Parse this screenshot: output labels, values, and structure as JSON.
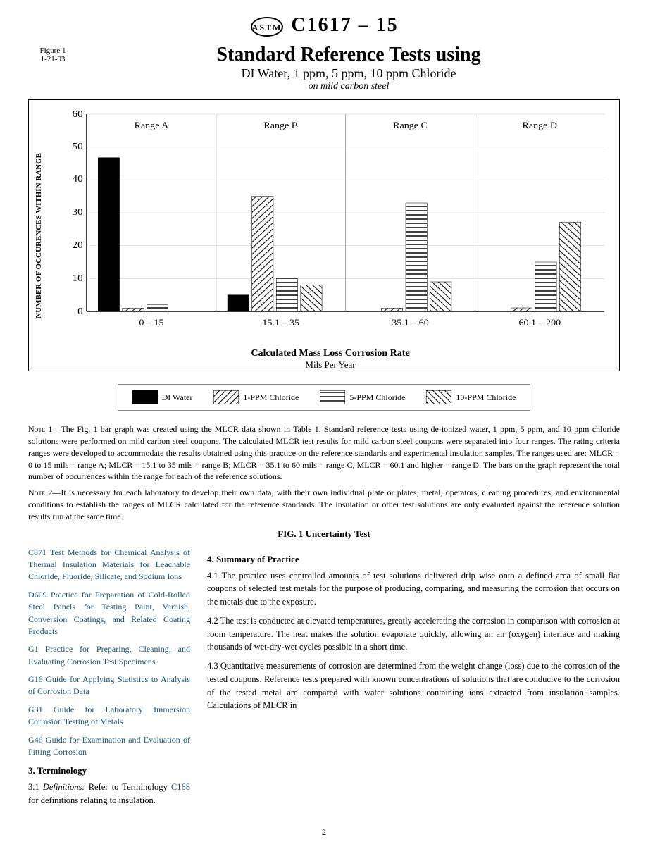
{
  "header": {
    "logo": "⚙",
    "standard": "C1617 – 15"
  },
  "figure": {
    "label": "Figure 1",
    "label2": "1-21-03",
    "title": "Standard Reference Tests using",
    "subtitle": "DI Water, 1 ppm, 5 ppm, 10 ppm Chloride",
    "sub2": "on mild carbon steel"
  },
  "chart": {
    "y_label": "NUMBER OF OCCURENCES WITHIN RANGE",
    "y_ticks": [
      "60",
      "50",
      "40",
      "30",
      "20",
      "10",
      "0"
    ],
    "ranges": [
      "Range A",
      "Range B",
      "Range C",
      "Range D"
    ],
    "x_labels": [
      "0 – 15",
      "15.1 – 35",
      "35.1 – 60",
      "60.1 – 200"
    ],
    "x_axis_label": "Calculated Mass Loss Corrosion Rate",
    "x_axis_sub": "Mils Per Year",
    "bars": {
      "rangeA": [
        47,
        1,
        2,
        0
      ],
      "rangeB": [
        5,
        35,
        10,
        8
      ],
      "rangeC": [
        0,
        1,
        33,
        9
      ],
      "rangeD": [
        0,
        0,
        15,
        27
      ]
    }
  },
  "legend": {
    "items": [
      {
        "label": "DI Water",
        "pattern": "solid"
      },
      {
        "label": "1-PPM Chloride",
        "pattern": "diagonal"
      },
      {
        "label": "5-PPM Chloride",
        "pattern": "horizontal"
      },
      {
        "label": "10-PPM Chloride",
        "pattern": "diagonal2"
      }
    ]
  },
  "notes": {
    "note1_label": "Note 1",
    "note1": "—The Fig. 1 bar graph was created using the MLCR data shown in Table 1. Standard reference tests using de-ionized water, 1 ppm, 5 ppm, and 10 ppm chloride solutions were performed on mild carbon steel coupons. The calculated MLCR test results for mild carbon steel coupons were separated into four ranges. The rating criteria ranges were developed to accommodate the results obtained using this practice on the reference standards and experimental insulation samples. The ranges used are: MLCR = 0 to 15 mils = range A; MLCR = 15.1 to 35 mils = range B; MLCR = 35.1 to 60 mils = range C, MLCR = 60.1 and higher = range D. The bars on the graph represent the total number of occurrences within the range for each of the reference solutions.",
    "note2_label": "Note 2",
    "note2": "—It is necessary for each laboratory to develop their own data, with their own individual plate or plates, metal, operators, cleaning procedures, and environmental conditions to establish the ranges of MLCR calculated for the reference standards. The insulation or other test solutions are only evaluated against the reference solution results run at the same time.",
    "fig_caption": "FIG. 1 Uncertainty Test"
  },
  "references": {
    "heading": "4.  Summary of Practice",
    "items": [
      {
        "code": "C871",
        "text": "Test Methods for Chemical Analysis of Thermal Insulation Materials for Leachable Chloride, Fluoride, Silicate, and Sodium Ions"
      },
      {
        "code": "D609",
        "text": "Practice for Preparation of Cold-Rolled Steel Panels for Testing Paint, Varnish, Conversion Coatings, and Related Coating Products"
      },
      {
        "code": "G1",
        "text": "Practice for Preparing, Cleaning, and Evaluating Corrosion Test Specimens"
      },
      {
        "code": "G16",
        "text": "Guide for Applying Statistics to Analysis of Corrosion Data"
      },
      {
        "code": "G31",
        "text": "Guide for Laboratory Immersion Corrosion Testing of Metals"
      },
      {
        "code": "G46",
        "text": "Guide for Examination and Evaluation of Pitting Corrosion"
      }
    ]
  },
  "terminology": {
    "heading": "3.  Terminology",
    "text": "3.1 Definitions: Refer to Terminology C168 for definitions relating to insulation."
  },
  "summary": {
    "heading": "4.  Summary of Practice",
    "para1": "4.1  The practice uses controlled amounts of test solutions delivered drip wise onto a defined area of small flat coupons of selected test metals for the purpose of producing, comparing, and measuring the corrosion that occurs on the metals due to the exposure.",
    "para2": "4.2  The test is conducted at elevated temperatures, greatly accelerating the corrosion in comparison with corrosion at room temperature. The heat makes the solution evaporate quickly, allowing an air (oxygen) interface and making thousands of wet-dry-wet cycles possible in a short time.",
    "para3": "4.3  Quantitative measurements of corrosion are determined from the weight change (loss) due to the corrosion of the tested coupons. Reference tests prepared with known concentrations of solutions that are conducive to the corrosion of the tested metal are compared with water solutions containing ions extracted from insulation samples. Calculations of MLCR in"
  },
  "page_number": "2"
}
